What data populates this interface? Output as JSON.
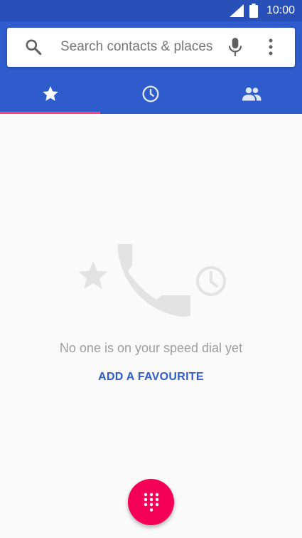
{
  "status_bar": {
    "time": "10:00",
    "signal_icon": "signal-icon",
    "battery_icon": "battery-icon"
  },
  "search": {
    "placeholder": "Search contacts & places",
    "search_icon": "search-icon",
    "mic_icon": "mic-icon",
    "more_icon": "more-vert-icon"
  },
  "tabs": [
    {
      "id": "speed-dial",
      "icon": "star-icon",
      "selected": true
    },
    {
      "id": "recents",
      "icon": "clock-icon",
      "selected": false
    },
    {
      "id": "contacts",
      "icon": "people-icon",
      "selected": false
    }
  ],
  "empty_state": {
    "message": "No one is on your speed dial yet",
    "action_label": "ADD A FAVOURITE"
  },
  "fab": {
    "icon": "dialpad-icon"
  },
  "colors": {
    "primary": "#2f5ccc",
    "status_bar": "#2850b8",
    "accent": "#ff4081",
    "fab": "#f50057",
    "background": "#fafafa"
  }
}
